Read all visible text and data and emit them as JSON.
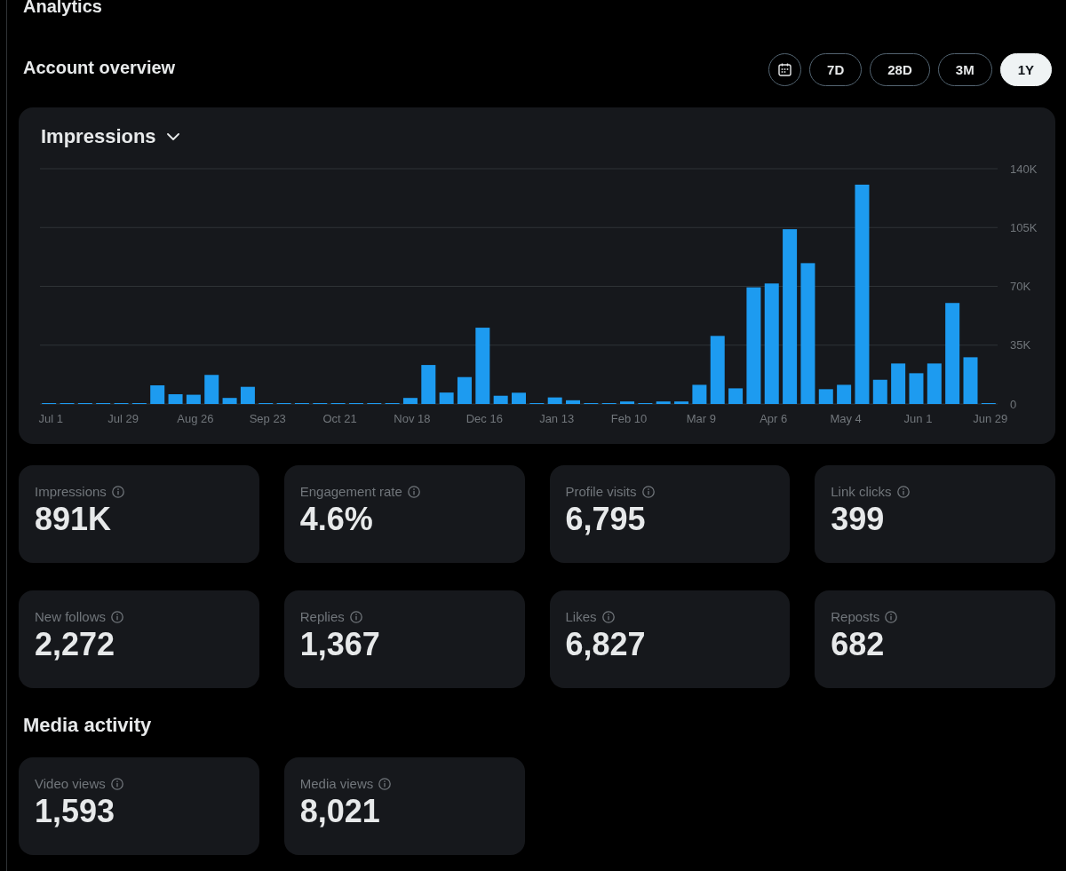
{
  "page": {
    "title": "Analytics"
  },
  "account_overview": {
    "title": "Account overview",
    "range_options": [
      {
        "kind": "calendar",
        "selected": false
      },
      {
        "kind": "range",
        "label": "7D",
        "selected": false
      },
      {
        "kind": "range",
        "label": "28D",
        "selected": false
      },
      {
        "kind": "range",
        "label": "3M",
        "selected": false
      },
      {
        "kind": "range",
        "label": "1Y",
        "selected": true
      }
    ],
    "chart_panel": {
      "metric_dropdown": {
        "label": "Impressions"
      },
      "chart_data": {
        "type": "bar",
        "grid": true,
        "categories": [
          "Jul 1",
          null,
          null,
          null,
          "Jul 29",
          null,
          null,
          null,
          "Aug 26",
          null,
          null,
          null,
          "Sep 23",
          null,
          null,
          null,
          "Oct 21",
          null,
          null,
          null,
          "Nov 18",
          null,
          null,
          null,
          "Dec 16",
          null,
          null,
          null,
          "Jan 13",
          null,
          null,
          null,
          "Feb 10",
          null,
          null,
          null,
          "Mar 9",
          null,
          null,
          null,
          "Apr 6",
          null,
          null,
          null,
          "May 4",
          null,
          null,
          null,
          "Jun 1",
          null,
          null,
          null,
          "Jun 29"
        ],
        "values": [
          400,
          400,
          400,
          400,
          400,
          400,
          11100,
          5800,
          5500,
          17300,
          3600,
          10200,
          400,
          400,
          400,
          400,
          400,
          400,
          400,
          400,
          3600,
          23200,
          6800,
          16000,
          45400,
          4900,
          6700,
          400,
          3900,
          2200,
          400,
          300,
          1500,
          400,
          1500,
          1500,
          11400,
          40500,
          9300,
          69400,
          71700,
          104000,
          83800,
          8800,
          11400,
          130500,
          14400,
          24100,
          18300,
          24100,
          60100,
          27800,
          300
        ],
        "ylim": [
          0,
          140000
        ],
        "yticks": [
          {
            "value": 0,
            "label": "0"
          },
          {
            "value": 35000,
            "label": "35K"
          },
          {
            "value": 70000,
            "label": "70K"
          },
          {
            "value": 105000,
            "label": "105K"
          },
          {
            "value": 140000,
            "label": "140K"
          }
        ]
      }
    },
    "stats": [
      {
        "label": "Impressions",
        "value": "891K"
      },
      {
        "label": "Engagement rate",
        "value": "4.6%"
      },
      {
        "label": "Profile visits",
        "value": "6,795"
      },
      {
        "label": "Link clicks",
        "value": "399"
      },
      {
        "label": "New follows",
        "value": "2,272"
      },
      {
        "label": "Replies",
        "value": "1,367"
      },
      {
        "label": "Likes",
        "value": "6,827"
      },
      {
        "label": "Reposts",
        "value": "682"
      }
    ]
  },
  "media_activity": {
    "title": "Media activity",
    "stats": [
      {
        "label": "Video views",
        "value": "1,593"
      },
      {
        "label": "Media views",
        "value": "8,021"
      }
    ]
  }
}
